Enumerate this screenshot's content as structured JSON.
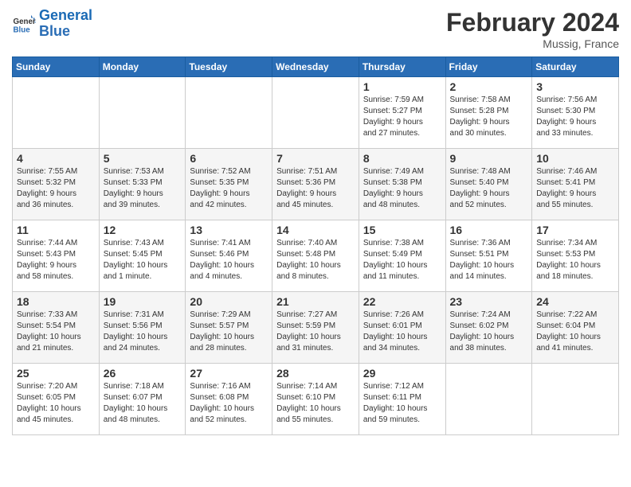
{
  "header": {
    "logo_line1": "General",
    "logo_line2": "Blue",
    "month_title": "February 2024",
    "location": "Mussig, France"
  },
  "weekdays": [
    "Sunday",
    "Monday",
    "Tuesday",
    "Wednesday",
    "Thursday",
    "Friday",
    "Saturday"
  ],
  "weeks": [
    [
      {
        "day": "",
        "info": ""
      },
      {
        "day": "",
        "info": ""
      },
      {
        "day": "",
        "info": ""
      },
      {
        "day": "",
        "info": ""
      },
      {
        "day": "1",
        "info": "Sunrise: 7:59 AM\nSunset: 5:27 PM\nDaylight: 9 hours\nand 27 minutes."
      },
      {
        "day": "2",
        "info": "Sunrise: 7:58 AM\nSunset: 5:28 PM\nDaylight: 9 hours\nand 30 minutes."
      },
      {
        "day": "3",
        "info": "Sunrise: 7:56 AM\nSunset: 5:30 PM\nDaylight: 9 hours\nand 33 minutes."
      }
    ],
    [
      {
        "day": "4",
        "info": "Sunrise: 7:55 AM\nSunset: 5:32 PM\nDaylight: 9 hours\nand 36 minutes."
      },
      {
        "day": "5",
        "info": "Sunrise: 7:53 AM\nSunset: 5:33 PM\nDaylight: 9 hours\nand 39 minutes."
      },
      {
        "day": "6",
        "info": "Sunrise: 7:52 AM\nSunset: 5:35 PM\nDaylight: 9 hours\nand 42 minutes."
      },
      {
        "day": "7",
        "info": "Sunrise: 7:51 AM\nSunset: 5:36 PM\nDaylight: 9 hours\nand 45 minutes."
      },
      {
        "day": "8",
        "info": "Sunrise: 7:49 AM\nSunset: 5:38 PM\nDaylight: 9 hours\nand 48 minutes."
      },
      {
        "day": "9",
        "info": "Sunrise: 7:48 AM\nSunset: 5:40 PM\nDaylight: 9 hours\nand 52 minutes."
      },
      {
        "day": "10",
        "info": "Sunrise: 7:46 AM\nSunset: 5:41 PM\nDaylight: 9 hours\nand 55 minutes."
      }
    ],
    [
      {
        "day": "11",
        "info": "Sunrise: 7:44 AM\nSunset: 5:43 PM\nDaylight: 9 hours\nand 58 minutes."
      },
      {
        "day": "12",
        "info": "Sunrise: 7:43 AM\nSunset: 5:45 PM\nDaylight: 10 hours\nand 1 minute."
      },
      {
        "day": "13",
        "info": "Sunrise: 7:41 AM\nSunset: 5:46 PM\nDaylight: 10 hours\nand 4 minutes."
      },
      {
        "day": "14",
        "info": "Sunrise: 7:40 AM\nSunset: 5:48 PM\nDaylight: 10 hours\nand 8 minutes."
      },
      {
        "day": "15",
        "info": "Sunrise: 7:38 AM\nSunset: 5:49 PM\nDaylight: 10 hours\nand 11 minutes."
      },
      {
        "day": "16",
        "info": "Sunrise: 7:36 AM\nSunset: 5:51 PM\nDaylight: 10 hours\nand 14 minutes."
      },
      {
        "day": "17",
        "info": "Sunrise: 7:34 AM\nSunset: 5:53 PM\nDaylight: 10 hours\nand 18 minutes."
      }
    ],
    [
      {
        "day": "18",
        "info": "Sunrise: 7:33 AM\nSunset: 5:54 PM\nDaylight: 10 hours\nand 21 minutes."
      },
      {
        "day": "19",
        "info": "Sunrise: 7:31 AM\nSunset: 5:56 PM\nDaylight: 10 hours\nand 24 minutes."
      },
      {
        "day": "20",
        "info": "Sunrise: 7:29 AM\nSunset: 5:57 PM\nDaylight: 10 hours\nand 28 minutes."
      },
      {
        "day": "21",
        "info": "Sunrise: 7:27 AM\nSunset: 5:59 PM\nDaylight: 10 hours\nand 31 minutes."
      },
      {
        "day": "22",
        "info": "Sunrise: 7:26 AM\nSunset: 6:01 PM\nDaylight: 10 hours\nand 34 minutes."
      },
      {
        "day": "23",
        "info": "Sunrise: 7:24 AM\nSunset: 6:02 PM\nDaylight: 10 hours\nand 38 minutes."
      },
      {
        "day": "24",
        "info": "Sunrise: 7:22 AM\nSunset: 6:04 PM\nDaylight: 10 hours\nand 41 minutes."
      }
    ],
    [
      {
        "day": "25",
        "info": "Sunrise: 7:20 AM\nSunset: 6:05 PM\nDaylight: 10 hours\nand 45 minutes."
      },
      {
        "day": "26",
        "info": "Sunrise: 7:18 AM\nSunset: 6:07 PM\nDaylight: 10 hours\nand 48 minutes."
      },
      {
        "day": "27",
        "info": "Sunrise: 7:16 AM\nSunset: 6:08 PM\nDaylight: 10 hours\nand 52 minutes."
      },
      {
        "day": "28",
        "info": "Sunrise: 7:14 AM\nSunset: 6:10 PM\nDaylight: 10 hours\nand 55 minutes."
      },
      {
        "day": "29",
        "info": "Sunrise: 7:12 AM\nSunset: 6:11 PM\nDaylight: 10 hours\nand 59 minutes."
      },
      {
        "day": "",
        "info": ""
      },
      {
        "day": "",
        "info": ""
      }
    ]
  ]
}
